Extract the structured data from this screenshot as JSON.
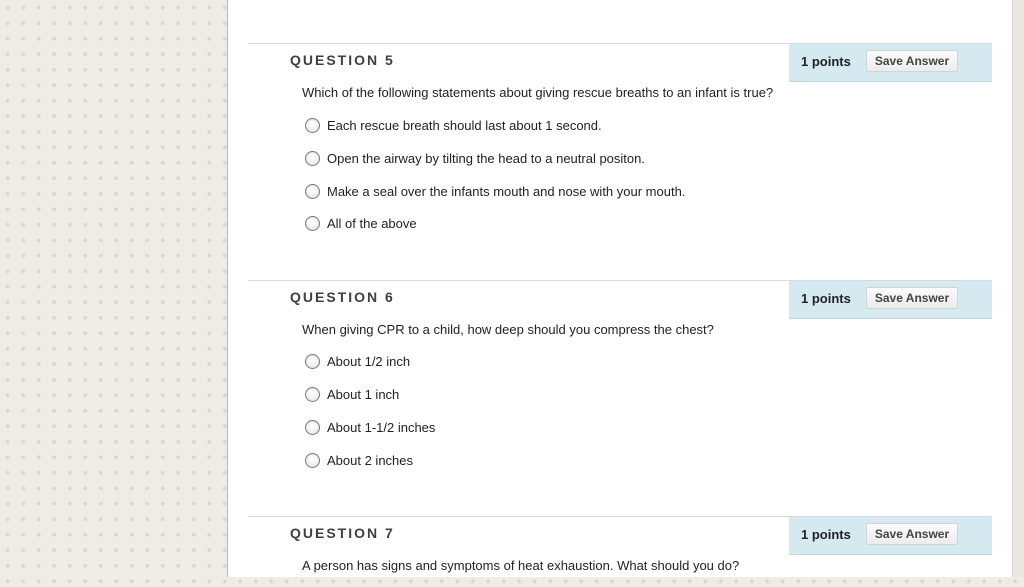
{
  "questions": [
    {
      "title": "QUESTION 5",
      "points": "1 points",
      "save_label": "Save Answer",
      "text": "Which of the following statements about giving rescue breaths to an infant is true?",
      "options": [
        "Each rescue breath should last about 1 second.",
        "Open the airway by tilting the head to a neutral positon.",
        "Make a seal over the infants mouth and nose with your mouth.",
        "All of the above"
      ]
    },
    {
      "title": "QUESTION 6",
      "points": "1 points",
      "save_label": "Save Answer",
      "text": "When giving CPR to a child, how deep should you compress the chest?",
      "options": [
        "About 1/2 inch",
        "About 1 inch",
        "About 1-1/2 inches",
        "About 2 inches"
      ]
    },
    {
      "title": "QUESTION 7",
      "points": "1 points",
      "save_label": "Save Answer",
      "text": "A person has signs and symptoms of heat exhaustion. What should you do?",
      "options": []
    }
  ],
  "colors": {
    "points_box_bg": "#d5e9f1",
    "page_bg": "#efebe6"
  }
}
